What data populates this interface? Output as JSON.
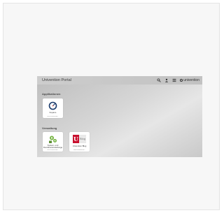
{
  "portal": {
    "title": "Univention Portal",
    "brand": "univention"
  },
  "sections": [
    {
      "title": "Applikationen",
      "tiles": [
        {
          "label": "Kopano",
          "sublabel": "ucs1959.local.univ..."
        }
      ]
    },
    {
      "title": "Verwaltung",
      "tiles": [
        {
          "label": "System- und Domäneneinstellungen",
          "label_line1": "System- und",
          "label_line2": "Domäneneinstellungen",
          "sublabel": "ucs1959.local.univ..."
        },
        {
          "label": "Univention Blog",
          "sublabel": "www.univention.de/..."
        }
      ]
    }
  ],
  "icons": {
    "search": "search-icon",
    "user": "user-icon",
    "menu": "menu-icon",
    "brand": "univention-logo-icon",
    "kopano": "kopano-gauge-icon",
    "system": "system-settings-gears-icon",
    "blog": "univention-blog-logo"
  },
  "blog_logo_text": "Blog",
  "blog_logo_letter": "U",
  "colors": {
    "kopano": "#1a3a6b",
    "kopano_accent": "#e8412c",
    "system_green": "#7ab648",
    "blog_red": "#c8102e"
  }
}
